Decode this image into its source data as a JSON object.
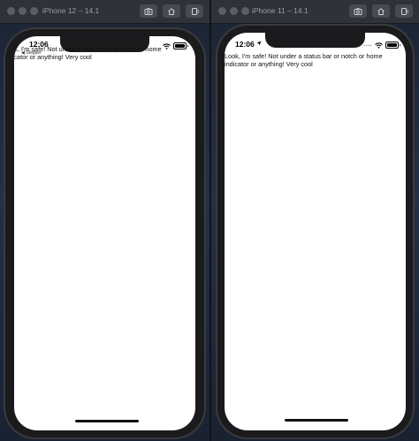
{
  "windows": [
    {
      "title": "iPhone 12 – 14.1",
      "time": "12:06",
      "back_label": "◀ Stepper",
      "content": "Look, I'm safe! Not under a status bar or notch or home indicator or anything! Very cool"
    },
    {
      "title": "iPhone 11 – 14.1",
      "time": "12:06",
      "content": "Look, I'm safe! Not under a status bar or notch or home indicator or anything! Very cool"
    }
  ],
  "toolbar_icons": [
    "screenshot-icon",
    "home-icon",
    "rotate-icon"
  ],
  "colors": {
    "window_chrome": "#2f3238",
    "desktop": "#1c2433",
    "phone_bezel": "#1b1b1d",
    "screen": "#ffffff"
  }
}
